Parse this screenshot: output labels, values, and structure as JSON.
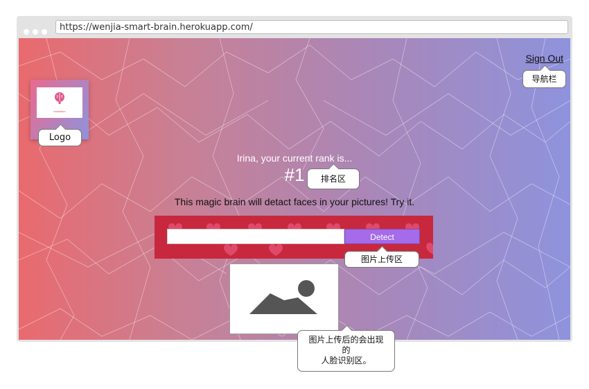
{
  "browser": {
    "url": "https://wenjia-smart-brain.herokuapp.com/"
  },
  "nav": {
    "sign_out": "Sign Out"
  },
  "logo": {
    "icon": "brain-icon",
    "text": "brainiakm"
  },
  "rank": {
    "line": "Irina, your current rank is...",
    "number": "#1"
  },
  "intro": "This magic brain will detact faces in your pictures! Try it.",
  "form": {
    "input_value": "",
    "detect_label": "Detect"
  },
  "face_area": {
    "icon": "image-placeholder-icon"
  },
  "annotations": {
    "nav": "导航栏",
    "logo": "Logo",
    "rank": "排名区",
    "upload": "图片上传区",
    "face_line1": "图片上传后的会出现",
    "face_line2": "的",
    "face_line3": "人脸识别区。"
  },
  "colors": {
    "gradient_left": "#e96a6e",
    "gradient_right": "#8e93dd",
    "form_bg": "#c8283d",
    "button": "#a56bea"
  }
}
